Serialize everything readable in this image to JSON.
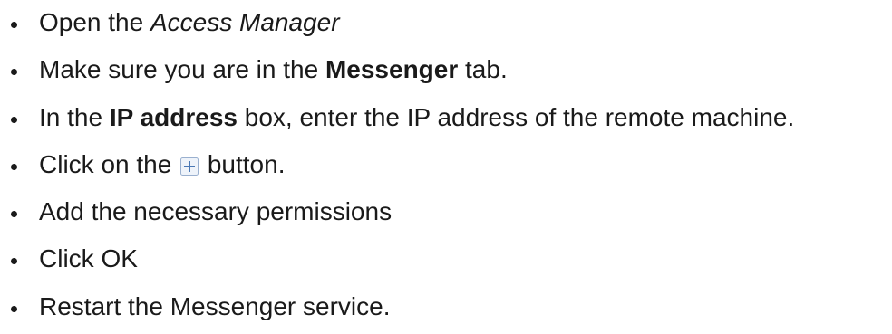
{
  "steps": [
    {
      "pre": "Open the ",
      "emph": "Access Manager"
    },
    {
      "pre": "Make sure you are in the ",
      "strong": "Messenger",
      "post": " tab."
    },
    {
      "pre": "In the ",
      "strong": "IP address",
      "post": " box, enter the IP address of the remote machine."
    },
    {
      "pre": "Click on the ",
      "icon": "plus-icon",
      "post": " button."
    },
    {
      "text": "Add the necessary permissions"
    },
    {
      "text": "Click OK"
    },
    {
      "text": "Restart the Messenger service."
    }
  ],
  "colors": {
    "text": "#1a1a1a",
    "icon_border": "#9ab0cf",
    "icon_fill": "#eef3fa",
    "icon_plus": "#4a78b5"
  }
}
